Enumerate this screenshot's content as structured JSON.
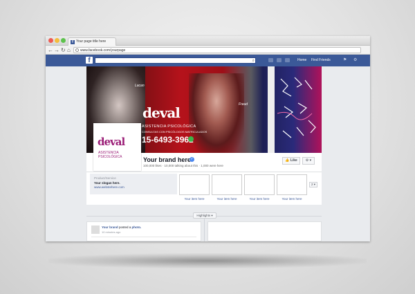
{
  "browser": {
    "tab_title": "Your page title here",
    "url": "www.facebook.com/yourpage",
    "fb_logo": "f",
    "nav": {
      "back": "←",
      "forward": "→",
      "reload": "↻",
      "home": "⌂"
    }
  },
  "fb_header": {
    "links": [
      "Home",
      "Find Friends"
    ],
    "search_icon": "⌕",
    "settings": "⚙"
  },
  "cover": {
    "brand_logo_text": "deval",
    "subtitle": "ASISTENCIA PSICOLÓGICA",
    "tagline": "CONSULTAS CON PSICÓLOGOS MATRICULADOS",
    "phone": "15-6493-3962",
    "label_left": "Lacan",
    "label_right": "Freud"
  },
  "profile": {
    "logo_text": "deval",
    "logo_sub": "ASISTENCIA PSICOLÓGICA"
  },
  "page_info": {
    "brand_name": "Your brand here",
    "verified_icon": "✓",
    "stats": "100,000 likes · 10,000 talking about this · 1,000 were here",
    "like_label": "Like",
    "like_icon": "👍",
    "gear_label": "⚙ ▾"
  },
  "about": {
    "category": "Product/Service",
    "slogan": "Your slogan here.",
    "website": "www.webstehere.com"
  },
  "apps": {
    "items": [
      {
        "label": "Your item here"
      },
      {
        "label": "Your item here"
      },
      {
        "label": "Your item here"
      },
      {
        "label": "Your item here"
      }
    ],
    "more": "2 ▾"
  },
  "timeline": {
    "highlights_label": "Highlights ▾",
    "post": {
      "author": "Your brand",
      "action": "posted a",
      "object": "photo.",
      "time": "10 minutes ago"
    }
  },
  "colors": {
    "facebook_blue": "#3b5998",
    "brand_purple": "#9b1e77",
    "cover_red": "#b5121b"
  }
}
